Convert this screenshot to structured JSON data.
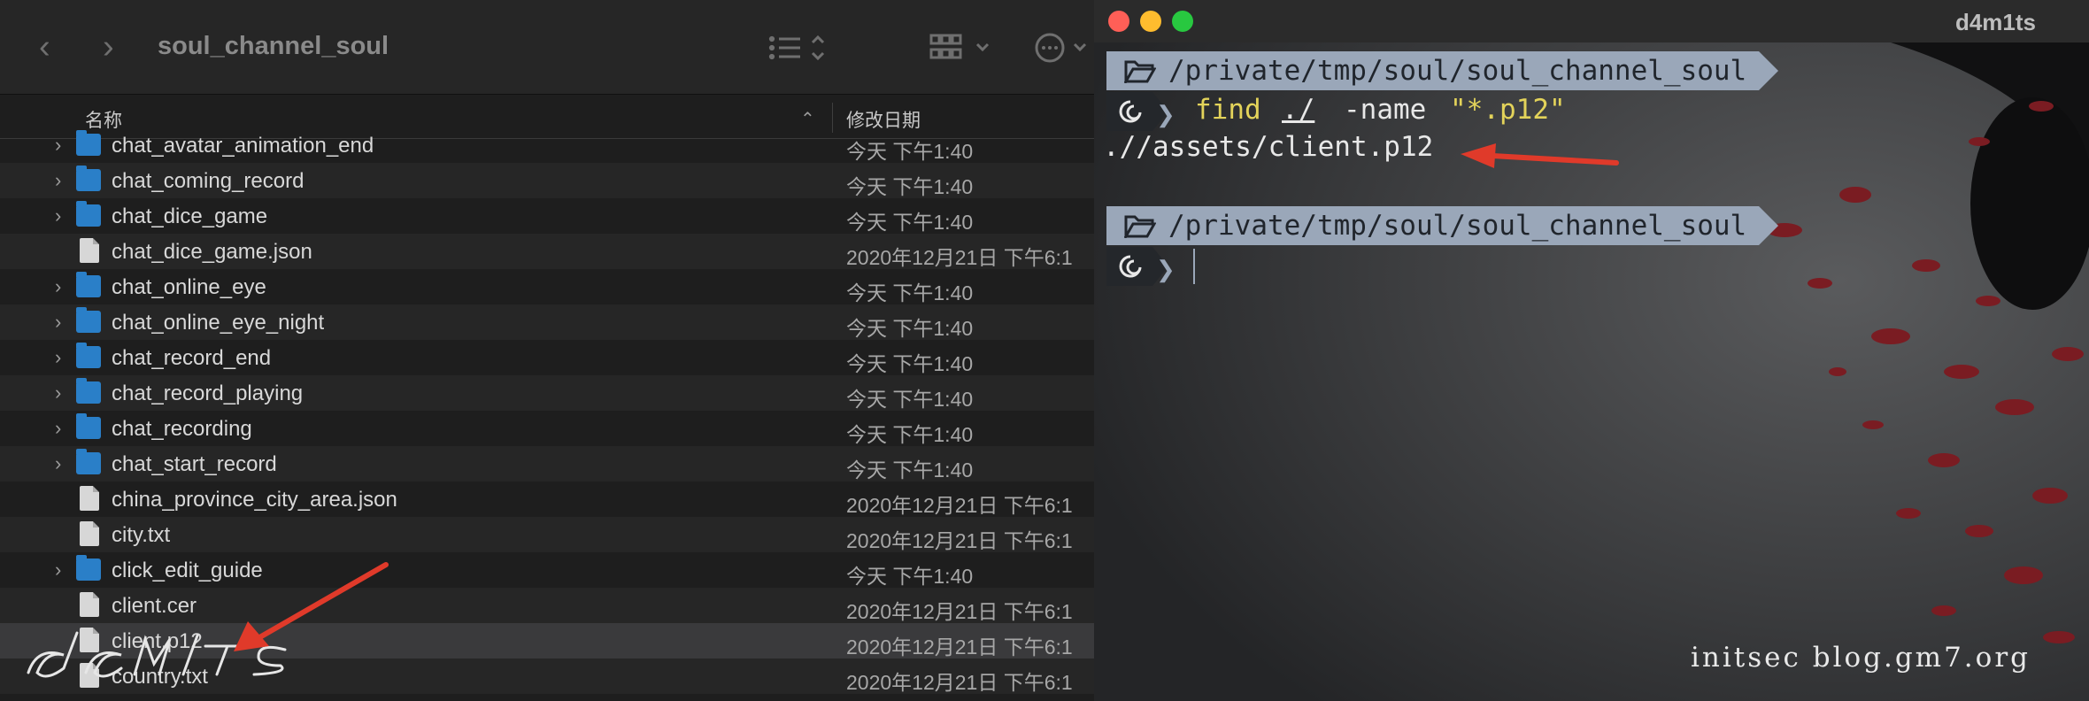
{
  "finder": {
    "folder_title": "soul_channel_soul",
    "columns": {
      "name": "名称",
      "date": "修改日期"
    },
    "rows": [
      {
        "name": "chat_avatar_animation_end",
        "date": "今天 下午1:40",
        "type": "folder"
      },
      {
        "name": "chat_coming_record",
        "date": "今天 下午1:40",
        "type": "folder"
      },
      {
        "name": "chat_dice_game",
        "date": "今天 下午1:40",
        "type": "folder"
      },
      {
        "name": "chat_dice_game.json",
        "date": "2020年12月21日 下午6:1",
        "type": "file"
      },
      {
        "name": "chat_online_eye",
        "date": "今天 下午1:40",
        "type": "folder"
      },
      {
        "name": "chat_online_eye_night",
        "date": "今天 下午1:40",
        "type": "folder"
      },
      {
        "name": "chat_record_end",
        "date": "今天 下午1:40",
        "type": "folder"
      },
      {
        "name": "chat_record_playing",
        "date": "今天 下午1:40",
        "type": "folder"
      },
      {
        "name": "chat_recording",
        "date": "今天 下午1:40",
        "type": "folder"
      },
      {
        "name": "chat_start_record",
        "date": "今天 下午1:40",
        "type": "folder"
      },
      {
        "name": "china_province_city_area.json",
        "date": "2020年12月21日 下午6:1",
        "type": "file"
      },
      {
        "name": "city.txt",
        "date": "2020年12月21日 下午6:1",
        "type": "file"
      },
      {
        "name": "click_edit_guide",
        "date": "今天 下午1:40",
        "type": "folder"
      },
      {
        "name": "client.cer",
        "date": "2020年12月21日 下午6:1",
        "type": "file"
      },
      {
        "name": "client.p12",
        "date": "2020年12月21日 下午6:1",
        "type": "file"
      },
      {
        "name": "country.txt",
        "date": "2020年12月21日 下午6:1",
        "type": "file"
      }
    ],
    "selected_row": "client.p12"
  },
  "terminal": {
    "window_title": "d4m1ts",
    "prompt_path": "/private/tmp/soul/soul_channel_soul",
    "command": {
      "cmd": "find",
      "arg": "./",
      "opt": "-name",
      "pattern": "\"*.p12\""
    },
    "output": ".//assets/client.p12"
  },
  "watermarks": {
    "right": "initsec blog.gm7.org"
  },
  "colors": {
    "arrow": "#e03a2a",
    "folder": "#2a7fc8",
    "prompt_bar": "#9aa7b9",
    "cmd_yellow": "#e3d35a"
  }
}
